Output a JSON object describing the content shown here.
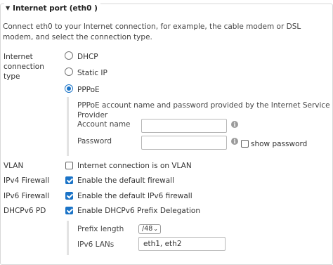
{
  "section": {
    "title": "Internet port (eth0 )",
    "description": "Connect eth0 to your Internet connection, for example, the cable modem or DSL modem, and select the connection type."
  },
  "connection_type": {
    "label": "Internet connection type",
    "options": [
      "DHCP",
      "Static IP",
      "PPPoE"
    ],
    "selected": "PPPoE"
  },
  "pppoe": {
    "description": "PPPoE account name and password provided by the Internet Service Provider",
    "account_name_label": "Account name",
    "account_name_value": "",
    "password_label": "Password",
    "password_value": "",
    "show_password_label": "show password",
    "show_password_checked": false
  },
  "vlan": {
    "label": "VLAN",
    "option": "Internet connection is on VLAN",
    "checked": false
  },
  "ipv4_firewall": {
    "label": "IPv4 Firewall",
    "option": "Enable the default firewall",
    "checked": true
  },
  "ipv6_firewall": {
    "label": "IPv6 Firewall",
    "option": "Enable the default IPv6 firewall",
    "checked": true
  },
  "dhcpv6_pd": {
    "label": "DHCPv6 PD",
    "option": "Enable DHCPv6 Prefix Delegation",
    "checked": true,
    "prefix_length_label": "Prefix length",
    "prefix_length_value": "/48",
    "ipv6_lans_label": "IPv6 LANs",
    "ipv6_lans_value": "eth1, eth2"
  },
  "colors": {
    "accent": "#1a73c7",
    "border": "#d8d8d8",
    "panel_rule": "#e3e3e3",
    "info_icon": "#9a9a9a"
  }
}
